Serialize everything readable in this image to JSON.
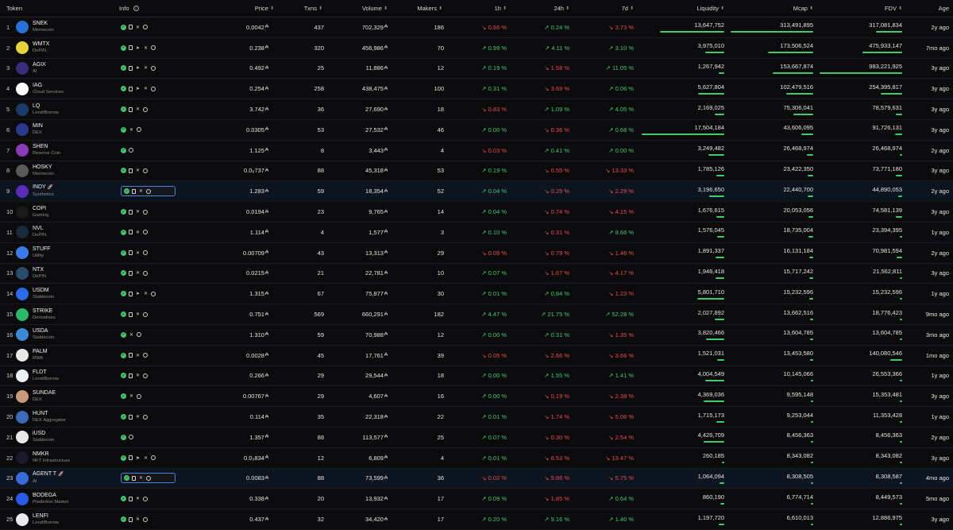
{
  "columns": {
    "token": "Token",
    "info": "Info",
    "price": "Price",
    "txns": "Txns",
    "volume": "Volume",
    "makers": "Makers",
    "h1": "1h",
    "h24": "24h",
    "d7": "7d",
    "liquidity": "Liquidity",
    "mcap": "Mcap",
    "fdv": "FDV",
    "age": "Age"
  },
  "colors": {
    "positive": "#3fcc6a",
    "negative": "#ee4b4b",
    "bar": "#3fcc6a",
    "highlight_border": "#4a7fd0"
  },
  "rows": [
    {
      "rank": "1",
      "symbol": "SNEK",
      "category": "Memecoin",
      "logo": "#2a6fd6",
      "icons": [
        "check",
        "doc",
        "x",
        "globe"
      ],
      "price": "0.0042",
      "txns": "437",
      "volume": "702,329",
      "makers": "186",
      "h1": "0.66 %",
      "h1_dir": "down",
      "h24": "0.24 %",
      "h24_dir": "up",
      "d7": "3.73 %",
      "d7_dir": "down",
      "liquidity": "13,647,752",
      "liq_frac": 0.78,
      "mcap": "313,491,895",
      "mcap_frac": 1.0,
      "fdv": "317,081,834",
      "fdv_frac": 0.32,
      "age": "2y ago"
    },
    {
      "rank": "2",
      "symbol": "WMTX",
      "category": "DePIN",
      "logo": "#e8d33a",
      "icons": [
        "check",
        "doc",
        "telegram",
        "x",
        "globe"
      ],
      "price": "0.238",
      "txns": "320",
      "volume": "456,986",
      "makers": "70",
      "h1": "0.99 %",
      "h1_dir": "up",
      "h24": "4.11 %",
      "h24_dir": "up",
      "d7": "3.10 %",
      "d7_dir": "up",
      "liquidity": "3,975,010",
      "liq_frac": 0.23,
      "mcap": "173,506,524",
      "mcap_frac": 0.55,
      "fdv": "475,933,147",
      "fdv_frac": 0.48,
      "age": "7mo ago"
    },
    {
      "rank": "3",
      "symbol": "AGIX",
      "category": "AI",
      "logo": "#3a2a7a",
      "icons": [
        "check",
        "doc",
        "telegram",
        "x",
        "globe"
      ],
      "price": "0.492",
      "txns": "25",
      "volume": "11,886",
      "makers": "12",
      "h1": "0.19 %",
      "h1_dir": "up",
      "h24": "1.58 %",
      "h24_dir": "down",
      "d7": "11.05 %",
      "d7_dir": "up",
      "liquidity": "1,267,942",
      "liq_frac": 0.07,
      "mcap": "153,667,874",
      "mcap_frac": 0.49,
      "fdv": "983,221,925",
      "fdv_frac": 1.0,
      "age": "3y ago"
    },
    {
      "rank": "4",
      "symbol": "IAG",
      "category": "Cloud Services",
      "logo": "#ffffff",
      "icons": [
        "check",
        "doc",
        "telegram",
        "x",
        "globe"
      ],
      "price": "0.254",
      "txns": "258",
      "volume": "438,475",
      "makers": "100",
      "h1": "0.31 %",
      "h1_dir": "up",
      "h24": "3.69 %",
      "h24_dir": "down",
      "d7": "0.06 %",
      "d7_dir": "up",
      "liquidity": "5,627,804",
      "liq_frac": 0.32,
      "mcap": "102,479,516",
      "mcap_frac": 0.33,
      "fdv": "254,395,817",
      "fdv_frac": 0.26,
      "age": "3y ago"
    },
    {
      "rank": "5",
      "symbol": "LQ",
      "category": "Lend/Borrow",
      "logo": "#1a3a6a",
      "icons": [
        "check",
        "doc",
        "x",
        "globe"
      ],
      "price": "3.742",
      "txns": "36",
      "volume": "27,690",
      "makers": "18",
      "h1": "0.83 %",
      "h1_dir": "down",
      "h24": "1.09 %",
      "h24_dir": "up",
      "d7": "4.05 %",
      "d7_dir": "up",
      "liquidity": "2,169,025",
      "liq_frac": 0.12,
      "mcap": "75,306,041",
      "mcap_frac": 0.24,
      "fdv": "78,579,631",
      "fdv_frac": 0.08,
      "age": "3y ago"
    },
    {
      "rank": "6",
      "symbol": "MIN",
      "category": "DEX",
      "logo": "#2a3a8a",
      "icons": [
        "check",
        "x",
        "globe"
      ],
      "price": "0.0305",
      "txns": "53",
      "volume": "27,532",
      "makers": "46",
      "h1": "0.00 %",
      "h1_dir": "up",
      "h24": "0.36 %",
      "h24_dir": "down",
      "d7": "0.68 %",
      "d7_dir": "up",
      "liquidity": "17,504,184",
      "liq_frac": 1.0,
      "mcap": "43,606,095",
      "mcap_frac": 0.14,
      "fdv": "91,726,131",
      "fdv_frac": 0.09,
      "age": "3y ago"
    },
    {
      "rank": "7",
      "symbol": "SHEN",
      "category": "Reserve Coin",
      "logo": "#8a3ab8",
      "icons": [
        "check",
        "globe"
      ],
      "price": "1.125",
      "txns": "8",
      "volume": "3,443",
      "makers": "4",
      "h1": "0.03 %",
      "h1_dir": "down",
      "h24": "0.41 %",
      "h24_dir": "up",
      "d7": "0.00 %",
      "d7_dir": "up",
      "liquidity": "3,249,482",
      "liq_frac": 0.19,
      "mcap": "26,468,974",
      "mcap_frac": 0.08,
      "fdv": "26,468,974",
      "fdv_frac": 0.03,
      "age": "2y ago"
    },
    {
      "rank": "8",
      "symbol": "HOSKY",
      "category": "Memecoin",
      "logo": "#5a5a5a",
      "icons": [
        "check",
        "doc",
        "x",
        "globe"
      ],
      "price": "0.0₆737",
      "txns": "88",
      "volume": "45,318",
      "makers": "53",
      "h1": "0.19 %",
      "h1_dir": "up",
      "h24": "0.55 %",
      "h24_dir": "down",
      "d7": "13.33 %",
      "d7_dir": "down",
      "liquidity": "1,785,126",
      "liq_frac": 0.1,
      "mcap": "23,422,350",
      "mcap_frac": 0.07,
      "fdv": "73,771,180",
      "fdv_frac": 0.08,
      "age": "3y ago"
    },
    {
      "rank": "9",
      "symbol": "INDY",
      "category": "Synthetics",
      "logo": "#5a2ab8",
      "rocket": true,
      "selected": true,
      "icons": [
        "check",
        "doc",
        "x",
        "globe"
      ],
      "price": "1.283",
      "txns": "59",
      "volume": "18,354",
      "makers": "52",
      "h1": "0.04 %",
      "h1_dir": "up",
      "h24": "0.25 %",
      "h24_dir": "down",
      "d7": "2.29 %",
      "d7_dir": "down",
      "liquidity": "3,196,650",
      "liq_frac": 0.18,
      "mcap": "22,440,700",
      "mcap_frac": 0.07,
      "fdv": "44,890,053",
      "fdv_frac": 0.05,
      "age": "2y ago"
    },
    {
      "rank": "10",
      "symbol": "COPI",
      "category": "Gaming",
      "logo": "#1a1a1a",
      "icons": [
        "check",
        "doc",
        "x",
        "globe"
      ],
      "price": "0.0194",
      "txns": "23",
      "volume": "9,765",
      "makers": "14",
      "h1": "0.04 %",
      "h1_dir": "up",
      "h24": "0.74 %",
      "h24_dir": "down",
      "d7": "4.15 %",
      "d7_dir": "down",
      "liquidity": "1,676,615",
      "liq_frac": 0.1,
      "mcap": "20,053,056",
      "mcap_frac": 0.06,
      "fdv": "74,581,139",
      "fdv_frac": 0.08,
      "age": "3y ago"
    },
    {
      "rank": "11",
      "symbol": "NVL",
      "category": "DePIN",
      "logo": "#1a2a3a",
      "icons": [
        "check",
        "doc",
        "x",
        "globe"
      ],
      "price": "1.114",
      "txns": "4",
      "volume": "1,577",
      "makers": "3",
      "h1": "0.10 %",
      "h1_dir": "up",
      "h24": "0.31 %",
      "h24_dir": "down",
      "d7": "8.66 %",
      "d7_dir": "up",
      "liquidity": "1,576,045",
      "liq_frac": 0.09,
      "mcap": "18,735,004",
      "mcap_frac": 0.06,
      "fdv": "23,394,395",
      "fdv_frac": 0.02,
      "age": "1y ago"
    },
    {
      "rank": "12",
      "symbol": "STUFF",
      "category": "Utility",
      "logo": "#3a7ae8",
      "icons": [
        "check",
        "doc",
        "x",
        "globe"
      ],
      "price": "0.00709",
      "txns": "43",
      "volume": "13,313",
      "makers": "29",
      "h1": "0.09 %",
      "h1_dir": "down",
      "h24": "0.79 %",
      "h24_dir": "down",
      "d7": "1.46 %",
      "d7_dir": "down",
      "liquidity": "1,891,337",
      "liq_frac": 0.11,
      "mcap": "16,131,184",
      "mcap_frac": 0.05,
      "fdv": "70,981,594",
      "fdv_frac": 0.07,
      "age": "2y ago"
    },
    {
      "rank": "13",
      "symbol": "NTX",
      "category": "DePIN",
      "logo": "#2a4a6a",
      "icons": [
        "check",
        "doc",
        "x",
        "globe"
      ],
      "price": "0.0215",
      "txns": "21",
      "volume": "22,781",
      "makers": "10",
      "h1": "0.07 %",
      "h1_dir": "up",
      "h24": "1.67 %",
      "h24_dir": "down",
      "d7": "4.17 %",
      "d7_dir": "down",
      "liquidity": "1,946,418",
      "liq_frac": 0.11,
      "mcap": "15,717,242",
      "mcap_frac": 0.05,
      "fdv": "21,562,811",
      "fdv_frac": 0.02,
      "age": "3y ago"
    },
    {
      "rank": "14",
      "symbol": "USDM",
      "category": "Stablecoin",
      "logo": "#2a6ae8",
      "icons": [
        "check",
        "doc",
        "telegram",
        "x",
        "globe"
      ],
      "price": "1.315",
      "txns": "67",
      "volume": "75,877",
      "makers": "30",
      "h1": "0.01 %",
      "h1_dir": "up",
      "h24": "0.84 %",
      "h24_dir": "up",
      "d7": "1.23 %",
      "d7_dir": "down",
      "liquidity": "5,801,710",
      "liq_frac": 0.33,
      "mcap": "15,232,596",
      "mcap_frac": 0.05,
      "fdv": "15,232,596",
      "fdv_frac": 0.02,
      "age": "1y ago"
    },
    {
      "rank": "15",
      "symbol": "STRIKE",
      "category": "Derivatives",
      "logo": "#2ab86a",
      "icons": [
        "check",
        "doc",
        "x",
        "globe"
      ],
      "price": "0.751",
      "txns": "569",
      "volume": "660,291",
      "makers": "182",
      "h1": "4.47 %",
      "h1_dir": "up",
      "h24": "21.75 %",
      "h24_dir": "up",
      "d7": "52.28 %",
      "d7_dir": "up",
      "liquidity": "2,027,892",
      "liq_frac": 0.12,
      "mcap": "13,662,516",
      "mcap_frac": 0.04,
      "fdv": "18,776,423",
      "fdv_frac": 0.02,
      "age": "9mo ago"
    },
    {
      "rank": "16",
      "symbol": "USDA",
      "category": "Stablecoin",
      "logo": "#3a8ad8",
      "icons": [
        "check",
        "x",
        "globe"
      ],
      "price": "1.310",
      "txns": "59",
      "volume": "70,988",
      "makers": "12",
      "h1": "0.00 %",
      "h1_dir": "up",
      "h24": "0.31 %",
      "h24_dir": "up",
      "d7": "1.35 %",
      "d7_dir": "down",
      "liquidity": "3,820,466",
      "liq_frac": 0.22,
      "mcap": "13,604,785",
      "mcap_frac": 0.04,
      "fdv": "13,604,785",
      "fdv_frac": 0.01,
      "age": "3mo ago"
    },
    {
      "rank": "17",
      "symbol": "PALM",
      "category": "RWA",
      "logo": "#e8e8e8",
      "icons": [
        "check",
        "doc",
        "x",
        "globe"
      ],
      "price": "0.0028",
      "txns": "45",
      "volume": "17,761",
      "makers": "39",
      "h1": "0.05 %",
      "h1_dir": "down",
      "h24": "2.66 %",
      "h24_dir": "down",
      "d7": "3.66 %",
      "d7_dir": "down",
      "liquidity": "1,521,031",
      "liq_frac": 0.09,
      "mcap": "13,453,580",
      "mcap_frac": 0.04,
      "fdv": "140,080,546",
      "fdv_frac": 0.14,
      "age": "1mo ago"
    },
    {
      "rank": "18",
      "symbol": "FLDT",
      "category": "Lend/Borrow",
      "logo": "#e8f0f0",
      "icons": [
        "check",
        "doc",
        "x",
        "globe"
      ],
      "price": "0.266",
      "txns": "29",
      "volume": "29,544",
      "makers": "18",
      "h1": "0.00 %",
      "h1_dir": "up",
      "h24": "1.55 %",
      "h24_dir": "up",
      "d7": "1.41 %",
      "d7_dir": "up",
      "liquidity": "4,004,549",
      "liq_frac": 0.23,
      "mcap": "10,145,066",
      "mcap_frac": 0.03,
      "fdv": "26,553,366",
      "fdv_frac": 0.03,
      "age": "1y ago"
    },
    {
      "rank": "19",
      "symbol": "SUNDAE",
      "category": "DEX",
      "logo": "#c89a7a",
      "icons": [
        "check",
        "x",
        "globe"
      ],
      "price": "0.00767",
      "txns": "29",
      "volume": "4,607",
      "makers": "16",
      "h1": "0.00 %",
      "h1_dir": "up",
      "h24": "0.19 %",
      "h24_dir": "down",
      "d7": "2.38 %",
      "d7_dir": "down",
      "liquidity": "4,369,036",
      "liq_frac": 0.25,
      "mcap": "9,595,148",
      "mcap_frac": 0.03,
      "fdv": "15,353,481",
      "fdv_frac": 0.02,
      "age": "3y ago"
    },
    {
      "rank": "20",
      "symbol": "HUNT",
      "category": "DEX Aggregator",
      "logo": "#3a6ab8",
      "icons": [
        "check",
        "doc",
        "x",
        "globe"
      ],
      "price": "0.114",
      "txns": "35",
      "volume": "22,318",
      "makers": "22",
      "h1": "0.01 %",
      "h1_dir": "up",
      "h24": "1.74 %",
      "h24_dir": "down",
      "d7": "5.06 %",
      "d7_dir": "down",
      "liquidity": "1,715,173",
      "liq_frac": 0.1,
      "mcap": "9,253,044",
      "mcap_frac": 0.03,
      "fdv": "11,353,428",
      "fdv_frac": 0.01,
      "age": "1y ago"
    },
    {
      "rank": "21",
      "symbol": "iUSD",
      "category": "Stablecoin",
      "logo": "#e8e8e8",
      "icons": [
        "check",
        "globe"
      ],
      "price": "1.357",
      "txns": "88",
      "volume": "113,577",
      "makers": "25",
      "h1": "0.07 %",
      "h1_dir": "up",
      "h24": "0.30 %",
      "h24_dir": "down",
      "d7": "2.54 %",
      "d7_dir": "down",
      "liquidity": "4,426,709",
      "liq_frac": 0.25,
      "mcap": "8,456,363",
      "mcap_frac": 0.03,
      "fdv": "8,456,363",
      "fdv_frac": 0.01,
      "age": "2y ago"
    },
    {
      "rank": "22",
      "symbol": "NMKR",
      "category": "NFT Infrastructure",
      "logo": "#1a1a2a",
      "icons": [
        "check",
        "doc",
        "telegram",
        "x",
        "globe"
      ],
      "price": "0.0₃834",
      "txns": "12",
      "volume": "6,809",
      "makers": "4",
      "h1": "0.01 %",
      "h1_dir": "up",
      "h24": "6.53 %",
      "h24_dir": "down",
      "d7": "13.47 %",
      "d7_dir": "down",
      "liquidity": "260,185",
      "liq_frac": 0.02,
      "mcap": "8,343,082",
      "mcap_frac": 0.03,
      "fdv": "8,343,082",
      "fdv_frac": 0.01,
      "age": "3y ago"
    },
    {
      "rank": "23",
      "symbol": "AGENT T",
      "category": "AI",
      "logo": "#3a6ad8",
      "rocket": true,
      "selected": true,
      "icons": [
        "check",
        "doc",
        "x",
        "globe"
      ],
      "price": "0.0083",
      "txns": "88",
      "volume": "73,599",
      "makers": "36",
      "h1": "0.02 %",
      "h1_dir": "down",
      "h24": "5.86 %",
      "h24_dir": "down",
      "d7": "5.75 %",
      "d7_dir": "down",
      "liquidity": "1,064,094",
      "liq_frac": 0.06,
      "mcap": "8,308,505",
      "mcap_frac": 0.03,
      "fdv": "8,308,587",
      "fdv_frac": 0.01,
      "age": "4mo ago"
    },
    {
      "rank": "24",
      "symbol": "BODEGA",
      "category": "Prediction Market",
      "logo": "#2a5ae8",
      "icons": [
        "check",
        "doc",
        "x",
        "globe"
      ],
      "price": "0.338",
      "txns": "20",
      "volume": "13,932",
      "makers": "17",
      "h1": "0.09 %",
      "h1_dir": "up",
      "h24": "1.85 %",
      "h24_dir": "down",
      "d7": "0.64 %",
      "d7_dir": "up",
      "liquidity": "860,190",
      "liq_frac": 0.05,
      "mcap": "6,774,714",
      "mcap_frac": 0.02,
      "fdv": "8,449,573",
      "fdv_frac": 0.01,
      "age": "5mo ago"
    },
    {
      "rank": "25",
      "symbol": "LENFI",
      "category": "Lend/Borrow",
      "logo": "#e8e8f0",
      "icons": [
        "check",
        "doc",
        "x",
        "globe"
      ],
      "price": "0.437",
      "txns": "32",
      "volume": "34,420",
      "makers": "17",
      "h1": "0.20 %",
      "h1_dir": "up",
      "h24": "9.16 %",
      "h24_dir": "up",
      "d7": "1.40 %",
      "d7_dir": "up",
      "liquidity": "1,197,720",
      "liq_frac": 0.07,
      "mcap": "6,610,013",
      "mcap_frac": 0.02,
      "fdv": "12,886,975",
      "fdv_frac": 0.01,
      "age": "3y ago"
    }
  ]
}
